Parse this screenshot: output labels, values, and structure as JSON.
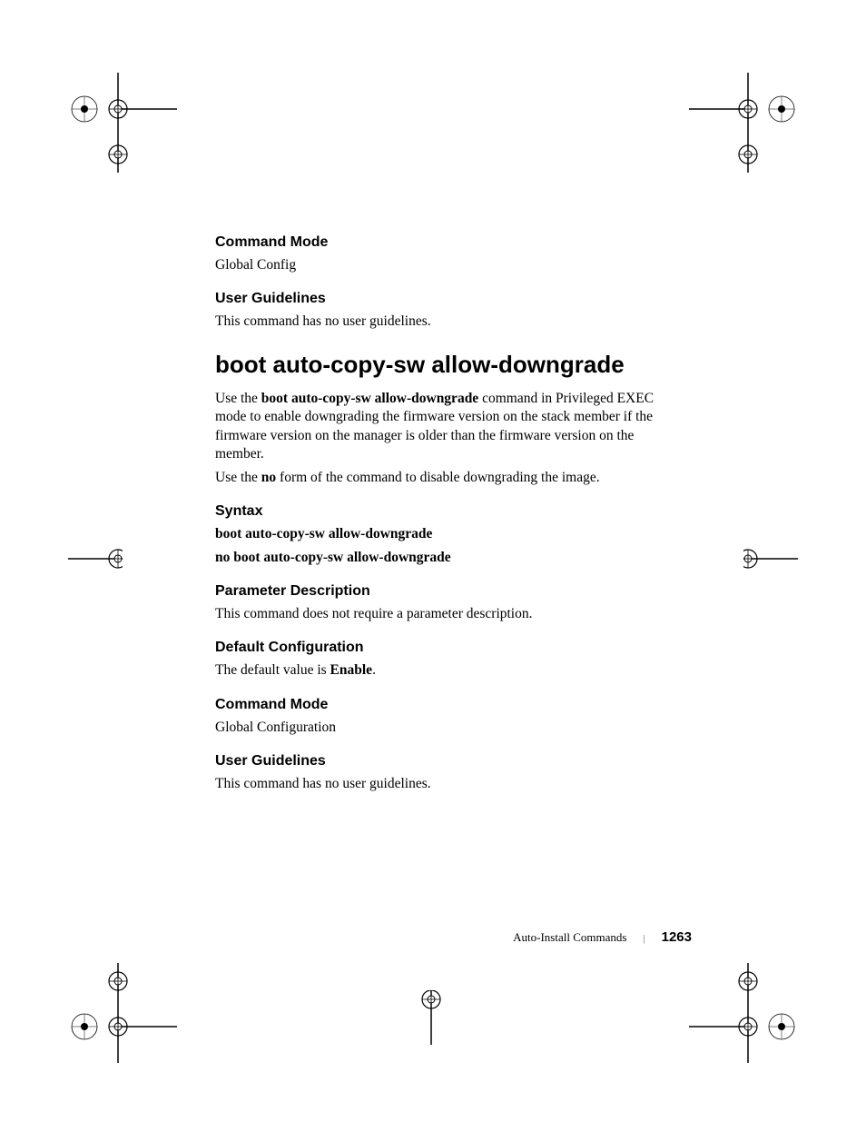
{
  "sections": {
    "s1": {
      "heading": "Command Mode",
      "body": "Global Config"
    },
    "s2": {
      "heading": "User Guidelines",
      "body": "This command has no user guidelines."
    },
    "main_heading": "boot auto-copy-sw allow-downgrade",
    "intro": {
      "pre1": "Use the ",
      "bold1": "boot auto-copy-sw allow-downgrade",
      "post1": " command in Privileged EXEC mode to enable downgrading the firmware version on the stack member if the firmware version on the manager is older than the firmware version on the member.",
      "pre2": "Use the ",
      "bold2": "no",
      "post2": " form of the command to disable downgrading the image."
    },
    "syntax": {
      "heading": "Syntax",
      "line1": "boot auto-copy-sw allow-downgrade",
      "line2": "no boot auto-copy-sw allow-downgrade"
    },
    "param": {
      "heading": "Parameter Description",
      "body": "This command does not require a parameter description."
    },
    "default": {
      "heading": "Default Configuration",
      "pre": "The default value is ",
      "bold": "Enable",
      "post": "."
    },
    "cmdmode2": {
      "heading": "Command Mode",
      "body": "Global Configuration"
    },
    "guidelines2": {
      "heading": "User Guidelines",
      "body": "This command has no user guidelines."
    }
  },
  "footer": {
    "chapter": "Auto-Install Commands",
    "separator": "|",
    "page": "1263"
  }
}
